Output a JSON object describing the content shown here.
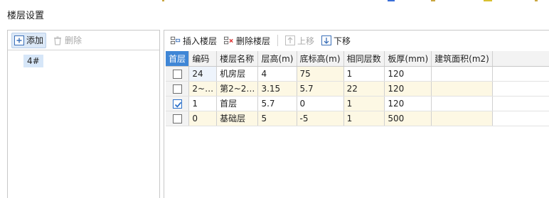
{
  "window": {
    "title": "楼层设置"
  },
  "left_toolbar": {
    "add_label": "添加",
    "delete_label": "删除"
  },
  "buildings": [
    {
      "name": "4#"
    }
  ],
  "right_toolbar": {
    "insert_label": "插入楼层",
    "delete_label": "删除楼层",
    "up_label": "上移",
    "down_label": "下移"
  },
  "table": {
    "headers": [
      "首层",
      "编码",
      "楼层名称",
      "层高(m)",
      "底标高(m)",
      "相同层数",
      "板厚(mm)",
      "建筑面积(m2)"
    ],
    "rows": [
      {
        "checked": false,
        "code": "24",
        "name": "机房层",
        "height": "4",
        "bottom": "75",
        "same": "1",
        "thick": "120",
        "area": ""
      },
      {
        "checked": false,
        "code": "2~…",
        "name": "第2~2…",
        "height": "3.15",
        "bottom": "5.7",
        "same": "22",
        "thick": "120",
        "area": ""
      },
      {
        "checked": true,
        "code": "1",
        "name": "首层",
        "height": "5.7",
        "bottom": "0",
        "same": "1",
        "thick": "120",
        "area": ""
      },
      {
        "checked": false,
        "code": "0",
        "name": "基础层",
        "height": "5",
        "bottom": "-5",
        "same": "1",
        "thick": "500",
        "area": ""
      }
    ]
  },
  "colors": {
    "accent": "#3f86d6",
    "row_highlight": "#fdf8e4",
    "selection": "#d6e6f8"
  }
}
